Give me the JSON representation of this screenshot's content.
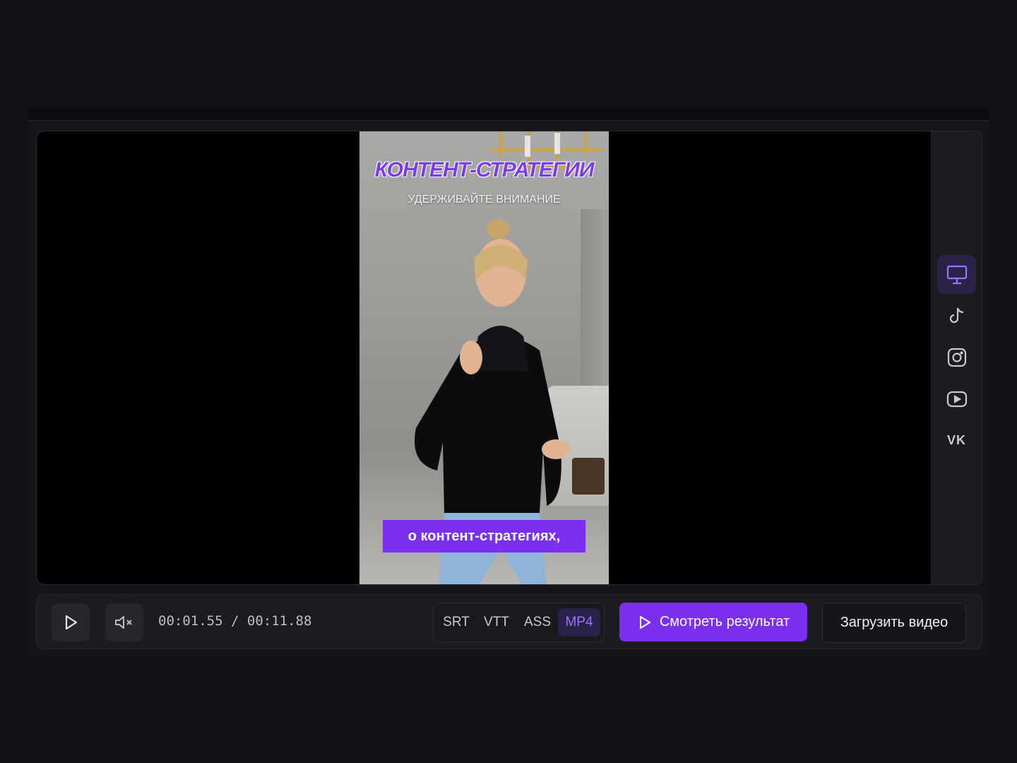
{
  "video": {
    "caption_title": "КОНТЕНТ-СТРАТЕГИИ",
    "caption_subtitle": "УДЕРЖИВАЙТЕ ВНИМАНИЕ",
    "caption_bottom": "о контент-стратегиях,"
  },
  "side_rail": {
    "items": [
      {
        "icon": "monitor-icon",
        "active": true
      },
      {
        "icon": "tiktok-icon",
        "active": false
      },
      {
        "icon": "instagram-icon",
        "active": false
      },
      {
        "icon": "youtube-icon",
        "active": false
      },
      {
        "icon": "vk-icon",
        "label": "VK",
        "active": false
      }
    ]
  },
  "controls": {
    "play_icon": "play-icon",
    "mute_icon": "speaker-muted-icon",
    "time_current": "00:01.55",
    "time_separator": "/",
    "time_total": "00:11.88",
    "formats": [
      {
        "label": "SRT",
        "active": false
      },
      {
        "label": "VTT",
        "active": false
      },
      {
        "label": "ASS",
        "active": false
      },
      {
        "label": "MP4",
        "active": true
      }
    ],
    "watch_result_label": "Смотреть результат",
    "upload_video_label": "Загрузить видео"
  },
  "colors": {
    "accent": "#7b2ff0",
    "accent_soft": "#9b73ff",
    "background": "#111116"
  }
}
